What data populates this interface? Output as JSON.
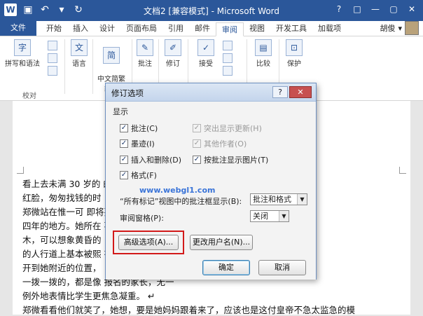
{
  "window": {
    "title": "文档2 [兼容模式] - Microsoft Word",
    "app_logo": "W",
    "controls": [
      "?",
      "□",
      "—",
      "▢",
      "✕"
    ]
  },
  "ribbon": {
    "tabs": [
      "文件",
      "开始",
      "插入",
      "设计",
      "页面布局",
      "引用",
      "邮件",
      "审阅",
      "视图",
      "开发工具",
      "加载项"
    ],
    "active_tab": "审阅",
    "user": "胡俊",
    "buttons": {
      "spell": "拼写和语法",
      "language": "语言",
      "convert": "中文简繁\n转换",
      "comment": "批注",
      "track": "修订",
      "accept": "接受",
      "compare": "比较",
      "protect": "保护"
    },
    "group_label": "校对"
  },
  "document": {
    "lines": [
      "看上去未满 30 岁的                                                                   的一句话闹了个大",
      "红脸，匆匆找钱的时",
      "    郑微站在惟一可                                                             即将要战斗和生活",
      "四年的地方。她所在                                                             不出名的亚热带树",
      "木，可以想象黄昏的                                                             ，然而现在整条路",
      "的人行道上基本被熙                                                             有私家车、出租车",
      "开到她附近的位置，                                                             占将新生接了过来，",
      "一拨一拨的，都是像                                                             报名的家长，无一",
      "例外地表情比学生更焦急凝重。 ↵",
      "    郑微看看他们就笑了，她想，要是她妈妈跟着来了，应该也是这付皇帝不急太监急的模"
    ]
  },
  "dialog": {
    "title": "修订选项",
    "help": "?",
    "close": "✕",
    "section": "显示",
    "checkboxes": [
      {
        "label": "批注(C)",
        "checked": true,
        "enabled": true
      },
      {
        "label": "突出显示更新(H)",
        "checked": true,
        "enabled": false
      },
      {
        "label": "墨迹(I)",
        "checked": true,
        "enabled": true
      },
      {
        "label": "其他作者(O)",
        "checked": true,
        "enabled": false
      },
      {
        "label": "插入和删除(D)",
        "checked": true,
        "enabled": true
      },
      {
        "label": "按批注显示图片(T)",
        "checked": true,
        "enabled": true
      },
      {
        "label": "格式(F)",
        "checked": true,
        "enabled": true
      }
    ],
    "balloon_label": "“所有标记”视图中的批注框显示(B):",
    "balloon_value": "批注和格式",
    "pane_label": "审阅窗格(P):",
    "pane_value": "关闭",
    "advanced_button": "高级选项(A)...",
    "username_button": "更改用户名(N)...",
    "ok_button": "确定",
    "cancel_button": "取消",
    "watermark": "www.webgl1.com"
  },
  "colors": {
    "accent": "#2b579a",
    "highlight_box": "#d21a1a",
    "close_red": "#c75050"
  }
}
